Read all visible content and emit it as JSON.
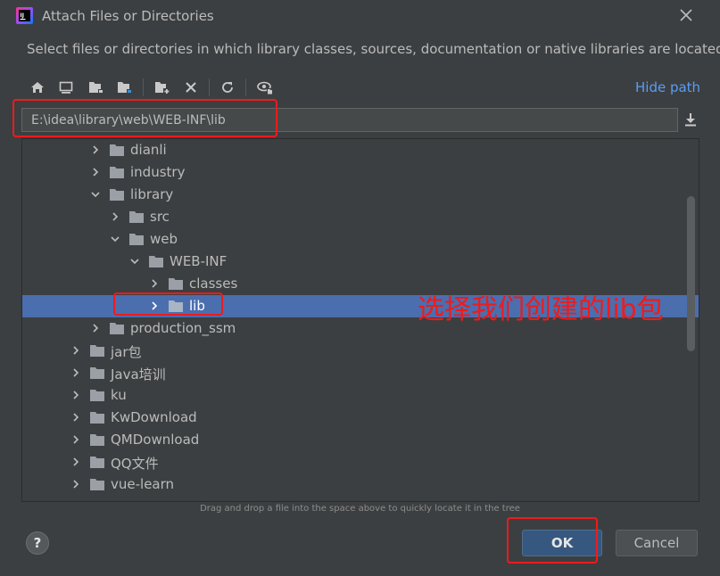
{
  "window": {
    "title": "Attach Files or Directories",
    "description": "Select files or directories in which library classes, sources, documentation or native libraries are located"
  },
  "toolbar": {
    "buttons": [
      {
        "name": "home-directory-icon"
      },
      {
        "name": "desktop-icon"
      },
      {
        "name": "project-directory-icon"
      },
      {
        "name": "module-directory-icon"
      },
      {
        "name": "new-folder-icon"
      },
      {
        "name": "delete-icon"
      },
      {
        "name": "refresh-icon"
      },
      {
        "name": "show-hidden-files-icon"
      }
    ],
    "hide_path_label": "Hide path"
  },
  "path": {
    "value": "E:\\idea\\library\\web\\WEB-INF\\lib"
  },
  "tree": {
    "items": [
      {
        "label": "dianli",
        "depth": 1,
        "expanded": false,
        "selected": false
      },
      {
        "label": "industry",
        "depth": 1,
        "expanded": false,
        "selected": false
      },
      {
        "label": "library",
        "depth": 1,
        "expanded": true,
        "selected": false
      },
      {
        "label": "src",
        "depth": 2,
        "expanded": false,
        "selected": false
      },
      {
        "label": "web",
        "depth": 2,
        "expanded": true,
        "selected": false
      },
      {
        "label": "WEB-INF",
        "depth": 3,
        "expanded": true,
        "selected": false
      },
      {
        "label": "classes",
        "depth": 4,
        "expanded": false,
        "selected": false
      },
      {
        "label": "lib",
        "depth": 4,
        "expanded": false,
        "selected": true
      },
      {
        "label": "production_ssm",
        "depth": 1,
        "expanded": false,
        "selected": false
      },
      {
        "label": "jar包",
        "depth": 0,
        "expanded": false,
        "selected": false
      },
      {
        "label": "Java培训",
        "depth": 0,
        "expanded": false,
        "selected": false
      },
      {
        "label": "ku",
        "depth": 0,
        "expanded": false,
        "selected": false
      },
      {
        "label": "KwDownload",
        "depth": 0,
        "expanded": false,
        "selected": false
      },
      {
        "label": "QMDownload",
        "depth": 0,
        "expanded": false,
        "selected": false
      },
      {
        "label": "QQ文件",
        "depth": 0,
        "expanded": false,
        "selected": false
      },
      {
        "label": "vue-learn",
        "depth": 0,
        "expanded": false,
        "selected": false
      }
    ]
  },
  "hint": "Drag and drop a file into the space above to quickly locate it in the tree",
  "buttons": {
    "help": "?",
    "ok": "OK",
    "cancel": "Cancel"
  },
  "annotation": {
    "text": "选择我们创建的lib包"
  },
  "colors": {
    "background": "#3c3f41",
    "selection": "#4b6eaf",
    "link": "#589df6",
    "annotation": "#ee1b1b",
    "primary_button": "#365880"
  }
}
